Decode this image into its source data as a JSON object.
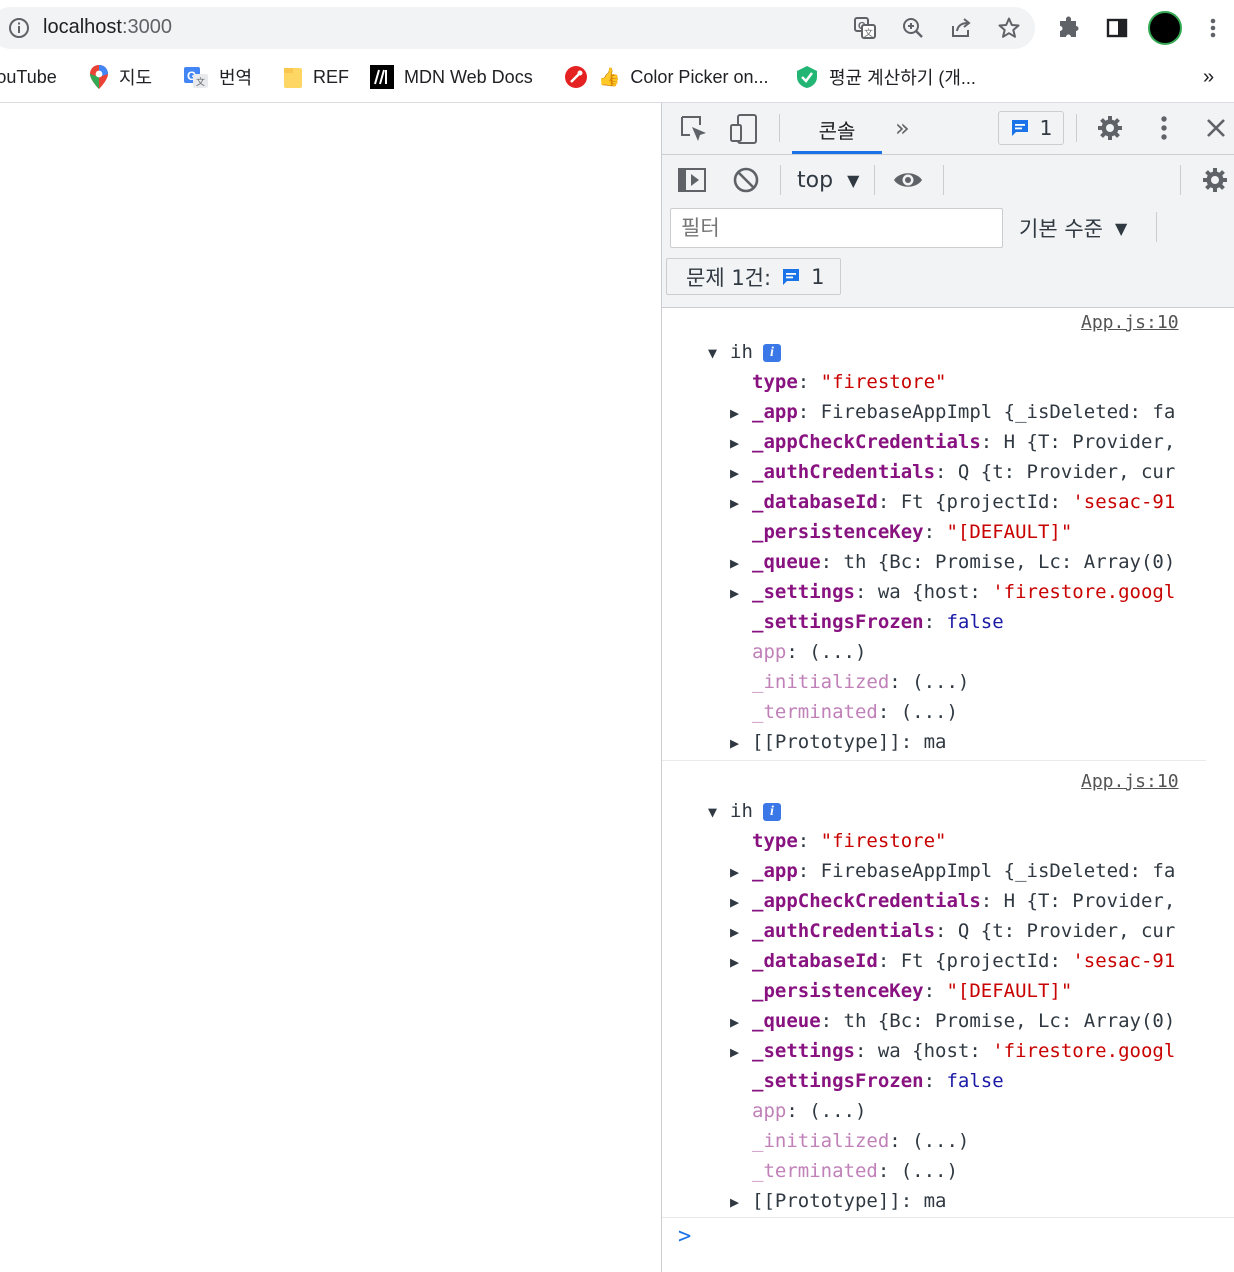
{
  "browser": {
    "url_host": "localhost",
    "url_port": ":3000",
    "bookmarks": [
      {
        "label": "YouTube",
        "icon": "youtube-icon"
      },
      {
        "label": "지도",
        "icon": "maps-icon"
      },
      {
        "label": "번역",
        "icon": "translate-icon"
      },
      {
        "label": "REF",
        "icon": "folder-icon"
      },
      {
        "label": "MDN Web Docs",
        "icon": "mdn-icon"
      },
      {
        "label": "Color Picker on...",
        "icon": "color-picker-icon"
      },
      {
        "label": "평균 계산하기 (개...",
        "icon": "shield-check-icon"
      }
    ],
    "bookmarks_overflow": "»"
  },
  "devtools": {
    "tab_console": "콘솔",
    "issues_count": "1",
    "context": "top",
    "filter_placeholder": "필터",
    "level": "기본 수준",
    "issues_label": "문제 1건:",
    "issues_label_count": "1"
  },
  "console": {
    "entries": [
      {
        "source": "App.js:10",
        "object_name": "ih",
        "props": [
          {
            "key": "type",
            "sep": ": ",
            "value": "\"firestore\""
          },
          {
            "key": "_app",
            "sep": ": ",
            "value": "FirebaseAppImpl {_isDeleted: fa"
          },
          {
            "key": "_appCheckCredentials",
            "sep": ": ",
            "value": "H {T: Provider,"
          },
          {
            "key": "_authCredentials",
            "sep": ": ",
            "value": "Q {t: Provider, cur"
          },
          {
            "key": "_databaseId",
            "sep": ": ",
            "value": "Ft {projectId: 'sesac-91"
          },
          {
            "key": "_persistenceKey",
            "sep": ": ",
            "value": "\"[DEFAULT]\""
          },
          {
            "key": "_queue",
            "sep": ": ",
            "value": "th {Bc: Promise, Lc: Array(0)"
          },
          {
            "key": "_settings",
            "sep": ": ",
            "value": "wa {host: 'firestore.googl"
          },
          {
            "key": "_settingsFrozen",
            "sep": ": ",
            "value": "false"
          },
          {
            "key": "app",
            "sep": ": ",
            "value": "(...)"
          },
          {
            "key": "_initialized",
            "sep": ": ",
            "value": "(...)"
          },
          {
            "key": "_terminated",
            "sep": ": ",
            "value": "(...)"
          },
          {
            "key": "[[Prototype]]",
            "sep": ": ",
            "value": "ma"
          }
        ]
      },
      {
        "source": "App.js:10",
        "object_name": "ih",
        "props": [
          {
            "key": "type",
            "sep": ": ",
            "value": "\"firestore\""
          },
          {
            "key": "_app",
            "sep": ": ",
            "value": "FirebaseAppImpl {_isDeleted: fa"
          },
          {
            "key": "_appCheckCredentials",
            "sep": ": ",
            "value": "H {T: Provider,"
          },
          {
            "key": "_authCredentials",
            "sep": ": ",
            "value": "Q {t: Provider, cur"
          },
          {
            "key": "_databaseId",
            "sep": ": ",
            "value": "Ft {projectId: 'sesac-91"
          },
          {
            "key": "_persistenceKey",
            "sep": ": ",
            "value": "\"[DEFAULT]\""
          },
          {
            "key": "_queue",
            "sep": ": ",
            "value": "th {Bc: Promise, Lc: Array(0)"
          },
          {
            "key": "_settings",
            "sep": ": ",
            "value": "wa {host: 'firestore.googl"
          },
          {
            "key": "_settingsFrozen",
            "sep": ": ",
            "value": "false"
          },
          {
            "key": "app",
            "sep": ": ",
            "value": "(...)"
          },
          {
            "key": "_initialized",
            "sep": ": ",
            "value": "(...)"
          },
          {
            "key": "_terminated",
            "sep": ": ",
            "value": "(...)"
          },
          {
            "key": "[[Prototype]]",
            "sep": ": ",
            "value": "ma"
          }
        ]
      }
    ],
    "prompt_symbol": ">"
  }
}
